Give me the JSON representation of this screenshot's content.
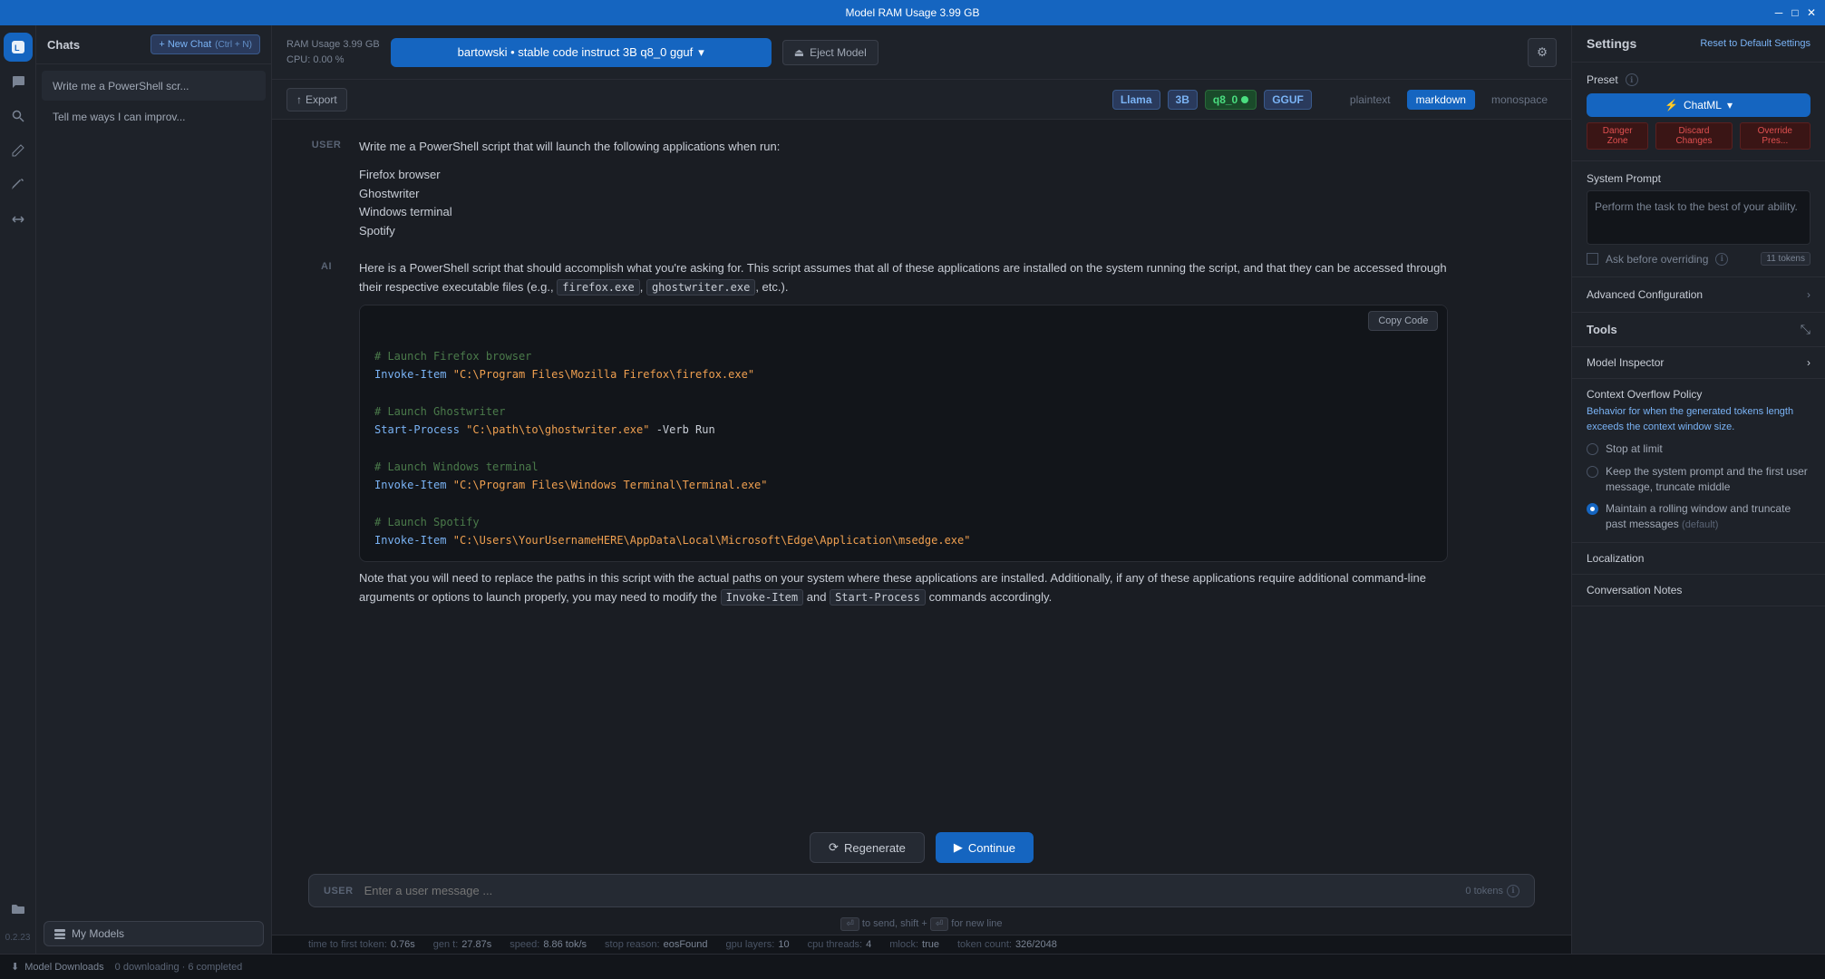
{
  "titlebar": {
    "title": "Model RAM Usage  3.99 GB",
    "controls": [
      "minimize",
      "maximize",
      "close"
    ]
  },
  "toolbar": {
    "ram_label": "RAM Usage",
    "ram_value": "3.99 GB",
    "cpu_label": "CPU:",
    "cpu_value": "0.00 %",
    "model_name": "bartowski • stable code instruct 3B q8_0 gguf",
    "model_chevron": "▾",
    "eject_label": "Eject Model",
    "settings_icon": "⚙"
  },
  "secondary_toolbar": {
    "export_label": "Export",
    "export_icon": "↑",
    "tags": {
      "llama": "Llama",
      "size": "3B",
      "quant": "q8_0",
      "format": "GGUF"
    },
    "format_options": [
      "plaintext",
      "markdown",
      "monospace"
    ],
    "active_format": "markdown"
  },
  "chat_sidebar": {
    "title": "Chats",
    "new_chat_label": "+ New Chat",
    "new_chat_shortcut": "(Ctrl + N)",
    "items": [
      {
        "text": "Write me a PowerShell scr...",
        "active": true
      },
      {
        "text": "Tell me ways I can improv..."
      }
    ]
  },
  "my_models_label": "My Models",
  "messages": [
    {
      "role": "USER",
      "type": "text",
      "content": "Write me a PowerShell script that will launch the following applications when run:\n\nFirefox browser\nGhostwriter\nWindows terminal\nSpotify"
    },
    {
      "role": "AI",
      "type": "mixed",
      "intro": "Here is a PowerShell script that should accomplish what you're asking for. This script assumes that all of these applications are installed on the system running the script, and that they can be accessed through their respective executable files (e.g., `firefox.exe`, `ghostwriter.exe`, etc.).",
      "code": "# Launch Firefox browser\nInvoke-Item \"C:\\Program Files\\Mozilla Firefox\\firefox.exe\"\n\n# Launch Ghostwriter\nStart-Process \"C:\\path\\to\\ghostwriter.exe\" -Verb Run\n\n# Launch Windows terminal\nInvoke-Item \"C:\\Program Files\\Windows Terminal\\Terminal.exe\"\n\n# Launch Spotify\nInvoke-Item \"C:\\Users\\YourUsernameHERE\\AppData\\Local\\Microsoft\\Edge\\Application\\msedge.exe\"",
      "outro": "Note that you will need to replace the paths in this script with the actual paths on your system where these applications are installed. Additionally, if any of these applications require additional command-line arguments or options to launch properly, you may need to modify the `Invoke-Item` and `Start-Process` commands accordingly."
    }
  ],
  "copy_code_label": "Copy Code",
  "actions": {
    "regenerate": "Regenerate",
    "continue": "Continue"
  },
  "input": {
    "user_label": "USER",
    "placeholder": "Enter a user message ...",
    "token_count": "0 tokens",
    "token_icon": "ℹ"
  },
  "shortcut_hint": "⏎ to send, shift + ⏎ for new line",
  "stats": {
    "time_to_first_token_label": "time to first token:",
    "time_to_first_token_value": "0.76s",
    "gen_t_label": "gen t:",
    "gen_t_value": "27.87s",
    "speed_label": "speed:",
    "speed_value": "8.86 tok/s",
    "stop_reason_label": "stop reason:",
    "stop_reason_value": "eosFound",
    "gpu_layers_label": "gpu layers:",
    "gpu_layers_value": "10",
    "cpu_threads_label": "cpu threads:",
    "cpu_threads_value": "4",
    "mlock_label": "mlock:",
    "mlock_value": "true",
    "token_count_label": "token count:",
    "token_count_value": "326/2048"
  },
  "settings": {
    "title": "Settings",
    "reset_label": "Reset to Default Settings",
    "preset_label": "Preset",
    "preset_value": "ChatML",
    "preset_chevron": "▾",
    "danger_zone_label": "Danger Zone",
    "discard_changes_label": "Discard Changes",
    "override_preset_label": "Override Pres...",
    "system_prompt_label": "System Prompt",
    "system_prompt_value": "Perform the task to the best of your ability.",
    "ask_override_label": "Ask before overriding",
    "token_badge_value": "11 tokens",
    "advanced_config_label": "Advanced Configuration",
    "tools_label": "Tools",
    "model_inspector_label": "Model Inspector",
    "context_overflow_label": "Context Overflow Policy",
    "context_overflow_desc": "Behavior for when the generated tokens length exceeds the context window size.",
    "radio_options": [
      {
        "label": "Stop at limit",
        "selected": false
      },
      {
        "label": "Keep the system prompt and the first user message, truncate middle",
        "selected": false
      },
      {
        "label": "Maintain a rolling window and truncate past messages (default)",
        "selected": true
      }
    ],
    "localization_label": "Localization",
    "conversation_notes_label": "Conversation Notes"
  },
  "version": "0.2.23",
  "bottom_bar": {
    "label": "Model Downloads",
    "status": "0 downloading · 6 completed"
  },
  "icons": {
    "chat": "💬",
    "chats_nav": "🗨",
    "search": "🔍",
    "pencil": "✏",
    "brush": "🖌",
    "arrows": "⇔",
    "folder": "📁",
    "settings": "⚙",
    "info": "ℹ",
    "chevron_right": "›",
    "expand": "⤡",
    "download": "⬇"
  }
}
